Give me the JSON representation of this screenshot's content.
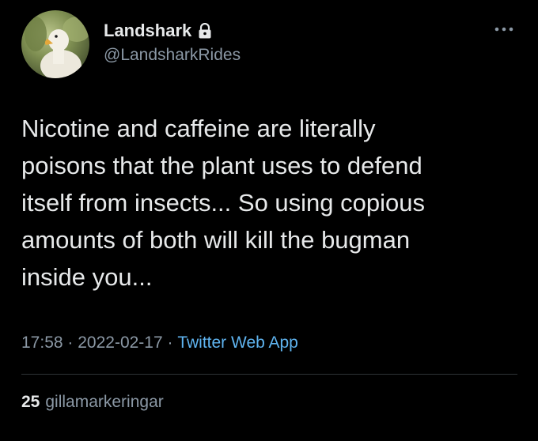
{
  "user": {
    "display_name": "Landshark",
    "handle": "@LandsharkRides",
    "avatar_icon": "duck-avatar",
    "protected_icon": "lock-icon"
  },
  "tweet": {
    "text": "Nicotine and caffeine are literally\npoisons that the plant uses to defend\nitself from insects... So using copious\namounts of both will kill the bugman\ninside you...",
    "time": "17:58",
    "date": "2022-02-17",
    "separator": " · ",
    "source": "Twitter Web App"
  },
  "stats": {
    "count": "25",
    "label": "gillamarkeringar"
  },
  "menu": {
    "more_icon": "more-horizontal-icon"
  },
  "colors": {
    "background": "#000000",
    "text_primary": "#e7e9ea",
    "text_secondary": "#8b98a5",
    "link": "#5fb4f0",
    "divider": "#2f3336"
  }
}
